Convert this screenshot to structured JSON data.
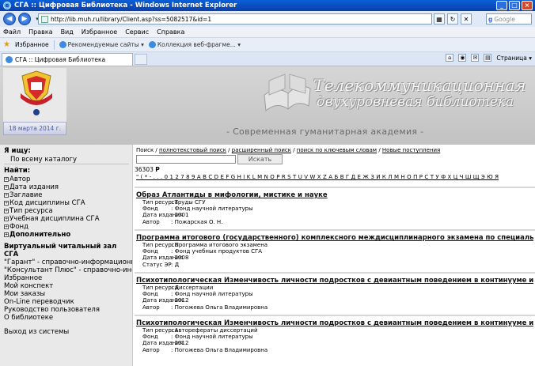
{
  "window": {
    "title": "СГА :: Цифровая Библиотека - Windows Internet Explorer",
    "buttons": [
      "_",
      "□",
      "×"
    ]
  },
  "address": {
    "url": "http://lib.muh.ru/library/Client.asp?ss=5082517&id=1",
    "search_placeholder": "Google"
  },
  "menu": [
    "Файл",
    "Правка",
    "Вид",
    "Избранное",
    "Сервис",
    "Справка"
  ],
  "favorites": {
    "label": "Избранное",
    "items": [
      "Рекомендуемые сайты ▾",
      "Коллекция веб-фрагме... ▾"
    ]
  },
  "tab": {
    "title": "СГА :: Цифровая Библиотека",
    "page_menu": "Страница ▾"
  },
  "header": {
    "date": "18 марта 2014 г.",
    "banner_line1": "Телекоммуникационная",
    "banner_line2": "двухуровневая библиотека",
    "academy": "- Современная гуманитарная академия -"
  },
  "sidebar": {
    "looking_for": "Я ищу:",
    "scope": "По всему каталогу",
    "find": "Найти:",
    "items": [
      {
        "label": "Автор",
        "bold": false
      },
      {
        "label": "Дата издания",
        "bold": false
      },
      {
        "label": "Заглавие",
        "bold": false
      },
      {
        "label": "Код дисциплины СГА",
        "bold": false
      },
      {
        "label": "Тип ресурса",
        "bold": false
      },
      {
        "label": "Учебная дисциплина СГА",
        "bold": false
      },
      {
        "label": "Фонд",
        "bold": false
      },
      {
        "label": "Дополнительно",
        "bold": true
      }
    ],
    "reading_room": "Виртуальный читальный зал СГА",
    "links": [
      "\"Гарант\" - справочно-информационная с",
      "\"Консультант Плюс\" - справочно-информ",
      "Избранное",
      "Мой конспект",
      "Мои заказы",
      "On-Line переводчик",
      "Руководство пользователя",
      "О библиотеке"
    ],
    "logout": "Выход из системы"
  },
  "search": {
    "links": [
      "Поиск",
      "полнотекстовый поиск",
      "расширенный поиск",
      "поиск по ключевым словам",
      "Новые поступления"
    ],
    "button": "Искать",
    "count": "36303",
    "count_letter": "Р",
    "alphabet": "\" ( * - . . . 0 1 2 7 8 9 A B C D E F G H I K L M N O P R S T U V W X Z А Б В Г Д Е Ж З И К Л М Н О П Р С Т У Ф Х Ц Ч Ш Щ Э Ю Я"
  },
  "results": [
    {
      "title": "Образ Атлантиды в мифологии, мистике и науке",
      "meta": [
        {
          "key": "Тип ресурса",
          "value": ":  Труды СГУ"
        },
        {
          "key": "Фонд",
          "value": ":  Фонд научной литературы"
        },
        {
          "key": "Дата издания",
          "value": ":  2001"
        },
        {
          "key": "Автор",
          "value": ":  Пожарская О. Н."
        }
      ]
    },
    {
      "title": "Программа итогового (государственного) комплексного междисциплинарного экзамена по специальност...",
      "meta": [
        {
          "key": "Тип ресурса",
          "value": ":  Программа итогового экзамена"
        },
        {
          "key": "Фонд",
          "value": ":  Фонд учебных продуктов СГА"
        },
        {
          "key": "Дата издания",
          "value": ":  2008"
        },
        {
          "key": "Статус ЭР",
          "value": ":  Д"
        }
      ]
    },
    {
      "title": "Психотипологическая Изменчивость личности подростков с девиантным поведением в континууме их жи...",
      "meta": [
        {
          "key": "Тип ресурса",
          "value": ":  Диссертации"
        },
        {
          "key": "Фонд",
          "value": ":  Фонд научной литературы"
        },
        {
          "key": "Дата издания",
          "value": ":  2012"
        },
        {
          "key": "Автор",
          "value": ":  Погожева Ольга Владимировна"
        }
      ]
    },
    {
      "title": "Психотипологическая Изменчивость личности подростков с девиантным поведением в континууме их жи...",
      "meta": [
        {
          "key": "Тип ресурса",
          "value": ":  Авторефераты диссертаций"
        },
        {
          "key": "Фонд",
          "value": ":  Фонд научной литературы"
        },
        {
          "key": "Дата издания",
          "value": ":  2012"
        },
        {
          "key": "Автор",
          "value": ":  Погожева Ольга Владимировна"
        }
      ]
    }
  ]
}
